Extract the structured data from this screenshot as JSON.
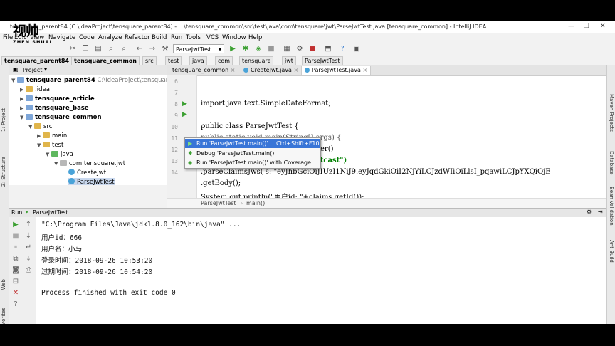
{
  "watermark": {
    "big": "视帅",
    "small": "ZHEN SHUAI"
  },
  "window": {
    "title": "tensquare_parent84 [C:\\IdeaProject\\tensquare_parent84] - ...\\tensquare_common\\src\\test\\java\\com\\tensquare\\jwt\\ParseJwtTest.java [tensquare_common] - IntelliJ IDEA"
  },
  "menu": [
    "File",
    "Edit",
    "View",
    "Navigate",
    "Code",
    "Analyze",
    "Refactor",
    "Build",
    "Run",
    "Tools",
    "VCS",
    "Window",
    "Help"
  ],
  "toolbar": {
    "run_config": "ParseJwtTest"
  },
  "breadcrumbs": [
    "tensquare_parent84",
    "tensquare_common",
    "src",
    "test",
    "java",
    "com",
    "tensquare",
    "jwt",
    "ParseJwtTest"
  ],
  "project": {
    "header": "Project",
    "items": [
      {
        "label": "tensquare_parent84",
        "detail": "C:\\IdeaProject\\tensquare_parent84"
      },
      {
        "label": ".idea"
      },
      {
        "label": "tensquare_article"
      },
      {
        "label": "tensquare_base"
      },
      {
        "label": "tensquare_common"
      },
      {
        "label": "src"
      },
      {
        "label": "main"
      },
      {
        "label": "test"
      },
      {
        "label": "java"
      },
      {
        "label": "com.tensquare.jwt"
      },
      {
        "label": "CreateJwt"
      },
      {
        "label": "ParseJwtTest"
      }
    ]
  },
  "left_strip": [
    "1: Project",
    "Z: Structure",
    "Web",
    "2: Favorites"
  ],
  "right_strip": [
    "Maven Projects",
    "Database",
    "Bean Validation",
    "Ant Build"
  ],
  "editor": {
    "tabs": [
      "tensquare_common",
      "CreateJwt.java",
      "ParseJwtTest.java"
    ],
    "lines": [
      {
        "n": "6",
        "text": "import java.text.SimpleDateFormat;"
      },
      {
        "n": "7",
        "text": ""
      },
      {
        "n": "8",
        "text": "public class ParseJwtTest {"
      },
      {
        "n": "9",
        "text": "    public static void main(String[] args) {"
      },
      {
        "n": "10",
        "text": "er()"
      },
      {
        "n": "11",
        "text": "itcast\")"
      },
      {
        "n": "12",
        "text": "            .parseClaimsJws( s: \"eyJhbGciOiJIUzI1NiJ9.eyJqdGkiOiI2NjYiLCJzdWIiOiLlsI_pqawiLCJpYXQiOjE"
      },
      {
        "n": "13",
        "text": "            .getBody();"
      },
      {
        "n": "14",
        "text": "        System.out.println(\"用户id: \"+claims.getId());"
      }
    ],
    "crumbs": [
      "ParseJwtTest",
      "main()"
    ]
  },
  "popup": {
    "items": [
      {
        "label": "Run 'ParseJwtTest.main()'",
        "shortcut": "Ctrl+Shift+F10",
        "selected": true
      },
      {
        "label": "Debug 'ParseJwtTest.main()'",
        "shortcut": ""
      },
      {
        "label": "Run 'ParseJwtTest.main()' with Coverage",
        "shortcut": ""
      }
    ]
  },
  "run": {
    "header_label": "Run",
    "header_tab": "ParseJwtTest",
    "console": [
      "\"C:\\Program Files\\Java\\jdk1.8.0_162\\bin\\java\" ...",
      "用户id：666",
      "用户名：小马",
      "登录时间：2018-09-26 10:53:20",
      "过期时间：2018-09-26 10:54:20",
      "",
      "Process finished with exit code 0"
    ]
  },
  "colors": {
    "selection": "#3875d7",
    "keyword": "#000080",
    "string": "#008000",
    "run_green": "#3ca032"
  }
}
